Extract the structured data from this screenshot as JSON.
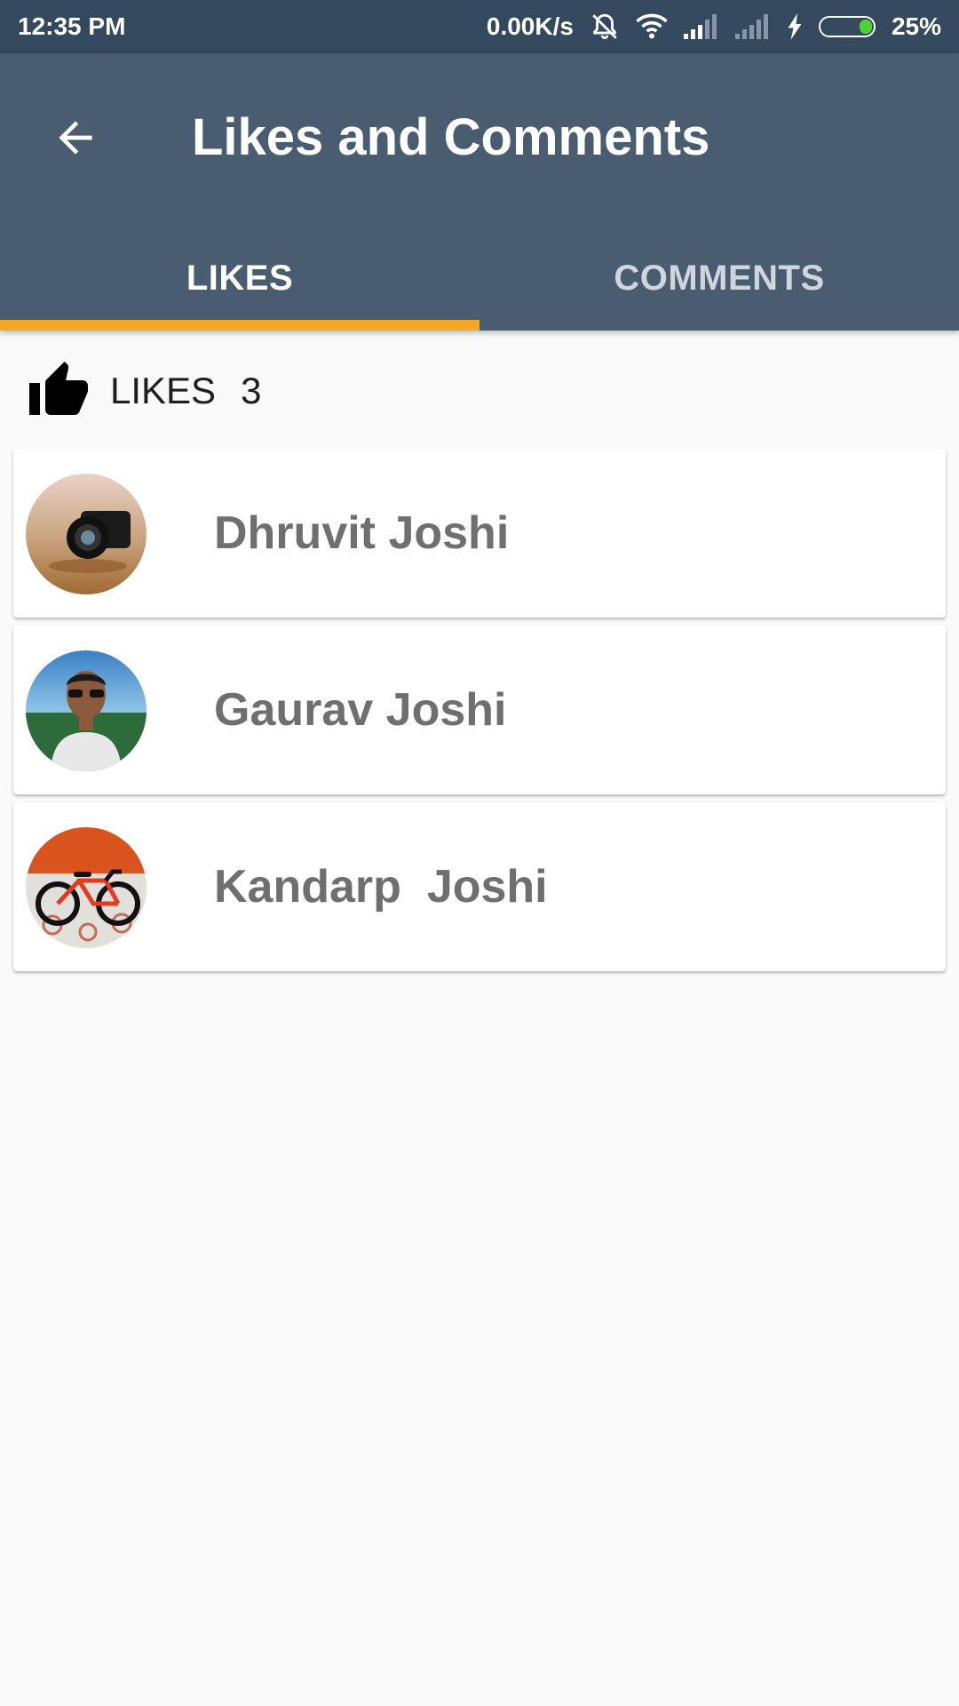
{
  "status_bar": {
    "time": "12:35 PM",
    "network_speed": "0.00K/s",
    "battery_percent": "25%",
    "battery_level": 0.25,
    "icons": [
      "alarm-off-icon",
      "wifi-icon",
      "signal-icon",
      "signal-icon",
      "charging-icon",
      "battery-icon"
    ]
  },
  "app_bar": {
    "title": "Likes and Comments",
    "back_icon": "arrow-left-icon"
  },
  "tabs": [
    {
      "label": "LIKES",
      "selected": true
    },
    {
      "label": "COMMENTS",
      "selected": false
    }
  ],
  "likes_header": {
    "icon": "thumbs-up-icon",
    "label": "LIKES",
    "count": "3"
  },
  "likes": [
    {
      "name": "Dhruvit Joshi",
      "avatar": "camera-photo"
    },
    {
      "name": "Gaurav Joshi",
      "avatar": "person-photo"
    },
    {
      "name": "Kandarp  Joshi",
      "avatar": "bicycle-photo"
    }
  ],
  "colors": {
    "status_bar": "#34495e",
    "app_bar": "#4a5d70",
    "tab_indicator": "#f5a623",
    "background": "#fafafa",
    "name_text": "#6f6f6f"
  }
}
